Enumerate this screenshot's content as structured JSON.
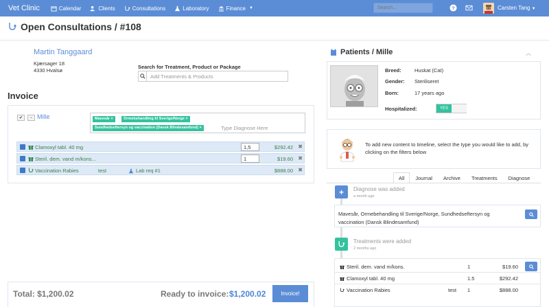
{
  "navbar": {
    "brand": "Vet Clinic",
    "items": [
      {
        "label": "Calendar",
        "icon": "calendar-icon"
      },
      {
        "label": "Clients",
        "icon": "users-icon"
      },
      {
        "label": "Consultations",
        "icon": "stethoscope-icon"
      },
      {
        "label": "Laboratory",
        "icon": "flask-icon"
      },
      {
        "label": "Finance",
        "icon": "bank-icon"
      }
    ],
    "search_placeholder": "Search...",
    "user": "Carsten Tang"
  },
  "page": {
    "title": "Open Consultations / #108"
  },
  "client": {
    "name": "Martin Tanggaard",
    "address_line1": "Kjærsager 18",
    "address_line2": "4330 Hvalsø"
  },
  "search": {
    "label": "Search for Treatment, Product or Package",
    "placeholder": "Add Treatments & Products"
  },
  "invoice": {
    "heading": "Invoice",
    "pet": "Mille",
    "diagnoses": [
      "Mavesår",
      "Ormebehandling til Sverige/Norge",
      "Sundhedseftersyn og vaccination (Dansk Blindesamfund)"
    ],
    "diagnose_placeholder": "Type Diagnose Here",
    "lines": [
      {
        "name": "Clamoxyl tabl. 40 mg",
        "qty": "1,5",
        "price": "$292.42"
      },
      {
        "name": "Steril. dem. vand m/kons...",
        "qty": "1",
        "price": "$19.60"
      },
      {
        "name": "Vaccination Rabies",
        "note": "test",
        "lab": "Lab req #1",
        "price": "$888.00"
      }
    ]
  },
  "footer": {
    "total": "Total: $1,200.02",
    "ready_label": "Ready to invoice:",
    "ready_amount": "$1,200.02",
    "invoice_button": "Invoice!"
  },
  "patient": {
    "title": "Patients / Mille",
    "breed_label": "Breed:",
    "breed": "Huskat (Cat)",
    "gender_label": "Gender:",
    "gender": "Steriliseret",
    "born_label": "Born:",
    "born": "17 years ago",
    "hospitalized_label": "Hospitalized:",
    "hospitalized": "YES"
  },
  "timeline": {
    "help": "To add new content to timeline, select the type you would like to add, by clicking on the filters below",
    "tabs": [
      "All",
      "Journal",
      "Archive",
      "Treatments",
      "Diagnose"
    ],
    "active_tab": "All",
    "events": [
      {
        "title": "Diagnose was added",
        "time": "a month ago",
        "text": "Mavesår, Ormebehandling til Sverige/Norge, Sundhedseftersyn og vaccination (Dansk Blindesamfund)"
      },
      {
        "title": "Treatments were added",
        "time": "2 months ago",
        "rows": [
          {
            "name": "Steril. dem. vand m/kons.",
            "note": "",
            "qty": "1",
            "price": "$19.60"
          },
          {
            "name": "Clamoxyl tabl. 40 mg",
            "note": "",
            "qty": "1.5",
            "price": "$292.42"
          },
          {
            "name": "Vaccination Rabies",
            "note": "test",
            "qty": "1",
            "price": "$888.00"
          }
        ]
      }
    ]
  },
  "colors": {
    "primary": "#5b8dd6",
    "success": "#33c29e",
    "row_bg": "#dde9f6"
  }
}
